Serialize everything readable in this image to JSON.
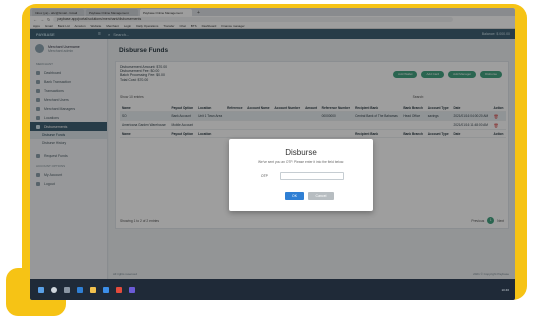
{
  "browser": {
    "tabs": [
      {
        "label": "Inbox (ya) - abc@Gmail - Gmail"
      },
      {
        "label": "Paybase Online Management"
      },
      {
        "label": "Paybase Online Management"
      }
    ],
    "new_tab": "+",
    "url": "paybase.app/portal/solutions/merchant/disbursements",
    "bookmarks": [
      "Apps",
      "Gmail",
      "Bank Ltd",
      "Amazon",
      "Website",
      "Merchant",
      "Login",
      "Daily Operations",
      "Transfer",
      "Chat",
      "BTS",
      "Dashboard",
      "Finance manager"
    ]
  },
  "app": {
    "logo": "PAYBASE",
    "menu_icon": "≡",
    "search_placeholder": "Search...",
    "balance": "Balance: $ 000.00"
  },
  "sidebar": {
    "user_name": "Merchant Username",
    "user_role": "Merchant admin",
    "section_main": "MERCHANT",
    "items": [
      {
        "label": "Dashboard"
      },
      {
        "label": "Bank Transaction"
      },
      {
        "label": "Transactions"
      },
      {
        "label": "Merchant Users"
      },
      {
        "label": "Merchant Managers"
      },
      {
        "label": "Locations"
      },
      {
        "label": "Disbursements"
      }
    ],
    "sub_items": [
      {
        "label": "Disburse Funds"
      },
      {
        "label": "Disburse History"
      }
    ],
    "extra_items": [
      {
        "label": "Request Funds"
      }
    ],
    "section_account": "ACCOUNT OPTIONS",
    "account_items": [
      {
        "label": "My Account"
      },
      {
        "label": "Logout"
      }
    ]
  },
  "main": {
    "title": "Disburse Funds",
    "summary": [
      "Disbursement Amount: $70.00",
      "Disbursement Fee: $0.00",
      "Batch Processing Fee: $0.00",
      "Total Cost: $70.00"
    ],
    "actions": [
      "Add Wallet",
      "Add Card",
      "Add Manager",
      "Disburse"
    ],
    "show_label": "Show 10 entries",
    "search_label": "Search:",
    "columns": [
      "Name",
      "Payout Option",
      "Location",
      "Reference",
      "Account Name",
      "Account Number",
      "Amount",
      "Reference Number",
      "Recipient Bank",
      "Bank Branch",
      "Account Type",
      "Date",
      "Action"
    ],
    "rows": [
      {
        "name": "SO",
        "payout": "Bank Account",
        "location": "Unit 1 Town Area",
        "reference": "",
        "acct_name": "",
        "acct_no": "",
        "amount": "",
        "ref_no": "00000000",
        "bank": "Central Bank of The Bahamas",
        "branch": "Head Office",
        "type": "savings",
        "date": "2021/01/16 04:00:20 AM",
        "action": "🗑"
      },
      {
        "name": "Americana Garden Warehouse",
        "payout": "Mobile Account",
        "location": "",
        "reference": "",
        "acct_name": "",
        "acct_no": "",
        "amount": "",
        "ref_no": "",
        "bank": "",
        "branch": "",
        "type": "",
        "date": "2021/01/16 11:48:00 AM",
        "action": "🗑"
      }
    ],
    "footer_columns": [
      "Name",
      "Payout Option",
      "Location",
      "",
      "",
      "",
      "",
      "",
      "Recipient Bank",
      "Bank Branch",
      "Account Type",
      "Date",
      "Action"
    ],
    "entries_info": "Showing 1 to 2 of 2 entries",
    "pagination": {
      "prev": "Previous",
      "page": "1",
      "next": "Next"
    },
    "footer_left": "All rights reserved",
    "footer_right": "2021 © Copyright Paybase"
  },
  "modal": {
    "title": "Disburse",
    "subtitle": "We've sent you an OTP. Please enter it into the field below.",
    "field_label": "OTP",
    "field_value": "",
    "ok_label": "OK",
    "cancel_label": "Cancel"
  },
  "taskbar": {
    "time": "10:46"
  },
  "colors": {
    "frame": "#f6c315",
    "header": "#3f6275",
    "accent_green": "#45a381",
    "ok_blue": "#2f7fd4"
  }
}
